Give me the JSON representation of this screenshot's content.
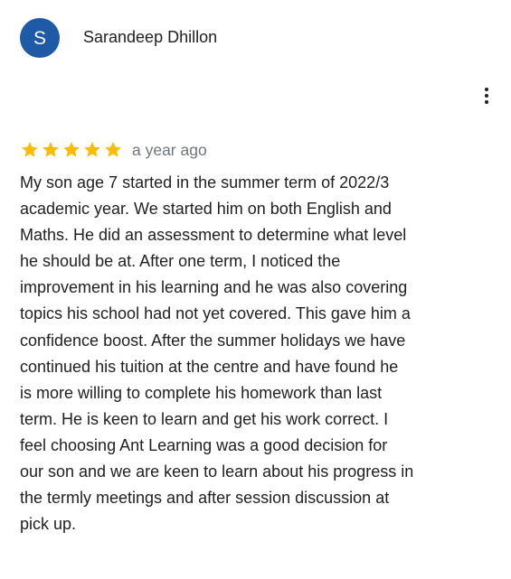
{
  "reviewer": {
    "avatar_letter": "S",
    "avatar_color": "#1f5aa6",
    "name": "Sarandeep Dhillon"
  },
  "review": {
    "rating": 5,
    "max_rating": 5,
    "star_color": "#fbbc04",
    "time_ago": "a year ago",
    "text": "My son age 7 started in the summer term of 2022/3\nacademic year. We started him on both English and\nMaths. He did an assessment to determine what level\nhe should be at. After one term, I noticed the\nimprovement in his learning and he was also covering\ntopics his school had not yet covered. This gave him a\nconfidence boost. After the summer holidays we have\ncontinued his tuition at the centre and have found he\nis more willing to complete his homework than last\nterm. He is keen to learn and get his work correct. I\nfeel choosing Ant Learning was a good decision for\nour son and we are keen to learn about his progress in\nthe termly meetings and after session discussion at\npick up."
  },
  "icons": {
    "more": "more-vert-icon",
    "star": "star-icon"
  }
}
